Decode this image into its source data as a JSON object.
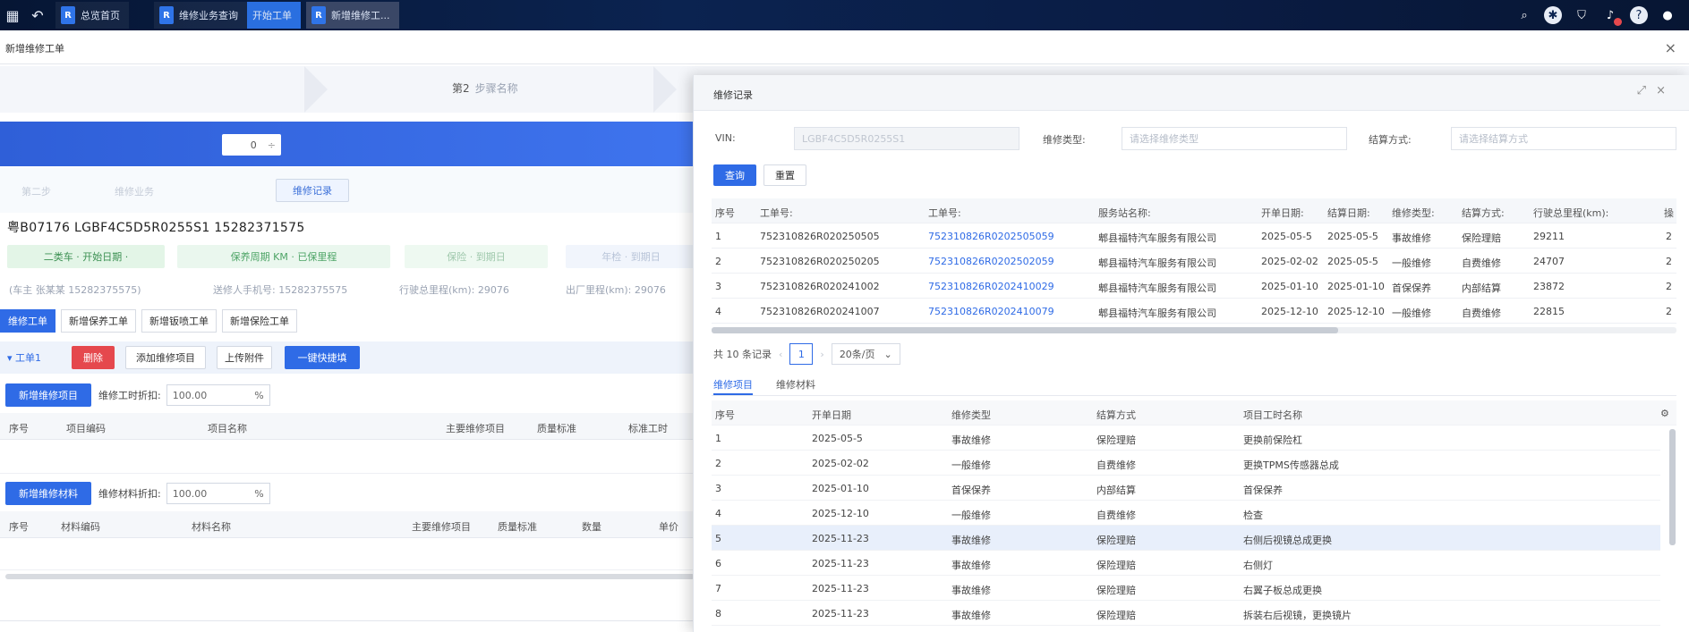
{
  "taskbar": {
    "tabs": [
      "总览首页",
      "维修业务查询",
      "开始工单",
      "新增维修工..."
    ],
    "icons": [
      "grid-icon",
      "back-icon",
      "search-icon",
      "settings-icon",
      "shield-icon",
      "bell-icon",
      "help-icon",
      "user-icon"
    ]
  },
  "window": {
    "title": "新增维修工单",
    "close": "×",
    "step_label_1": "第2",
    "step_label_2": "步骤名称"
  },
  "left": {
    "band_value": "0",
    "band_caret": "÷",
    "faint_1": "第二步",
    "faint_2": "维修业务",
    "history_button": "维修记录",
    "plate_line": "粤B07176  LGBF4C5D5R0255S1  15282371575",
    "chips": [
      "二类车 · 开始日期 ·",
      "保养周期 KM · 已保里程",
      "保险 · 到期日",
      "年检 · 到期日"
    ],
    "info": [
      "(车主 张某某 15282375575)",
      "送修人手机号: 15282375575",
      "行驶总里程(km): 29076",
      "出厂里程(km): 29076"
    ],
    "sub_tabs": [
      "维修工单",
      "新增保养工单",
      "新增钣喷工单",
      "新增保险工单"
    ],
    "section_toggle": "▾ 工单1",
    "btn_delete": "删除",
    "btn_add_project": "添加维修项目",
    "btn_upload": "上传附件",
    "btn_one_click": "一键快捷填",
    "btn_add_item": "新增维修项目",
    "discount_label": "维修工时折扣:",
    "discount_value": "100.00",
    "percent": "%",
    "table1_headers": [
      "序号",
      "项目编码",
      "项目名称",
      "主要维修项目",
      "质量标准",
      "标准工时"
    ],
    "btn_add_material": "新增维修材料",
    "material_label": "维修材料折扣:",
    "material_value": "100.00",
    "table2_headers": [
      "序号",
      "材料编码",
      "材料名称",
      "主要维修项目",
      "质量标准",
      "数量",
      "单价"
    ]
  },
  "modal": {
    "title": "维修记录",
    "max_icon": "⤢",
    "close_icon": "×",
    "vin_label": "VIN:",
    "vin_value": "LGBF4C5D5R0255S1",
    "type_label": "维修类型:",
    "type_placeholder": "请选择维修类型",
    "method_label": "结算方式:",
    "method_placeholder": "请选择结算方式",
    "search_btn": "查询",
    "reset_btn": "重置",
    "grid_headers": [
      "序号",
      "工单号:",
      "工单号:",
      "服务站名称:",
      "开单日期:",
      "结算日期:",
      "维修类型:",
      "结算方式:",
      "行驶总里程(km):",
      "操"
    ],
    "grid_rows": [
      [
        "1",
        "752310826R020250505",
        "752310826R0202505059",
        "郫县福特汽车服务有限公司",
        "2025-05-5",
        "2025-05-5",
        "事故维修",
        "保险理赔",
        "29211",
        "2"
      ],
      [
        "2",
        "752310826R020250205",
        "752310826R0202502059",
        "郫县福特汽车服务有限公司",
        "2025-02-02",
        "2025-05-5",
        "一般维修",
        "自费维修",
        "24707",
        "2"
      ],
      [
        "3",
        "752310826R020241002",
        "752310826R0202410029",
        "郫县福特汽车服务有限公司",
        "2025-01-10",
        "2025-01-10",
        "首保保养",
        "内部结算",
        "23872",
        "2"
      ],
      [
        "4",
        "752310826R020241007",
        "752310826R0202410079",
        "郫县福特汽车服务有限公司",
        "2025-12-10",
        "2025-12-10",
        "一般维修",
        "自费维修",
        "22815",
        "2"
      ]
    ],
    "pager_total": "共 10 条记录",
    "pager_prev": "‹",
    "pager_page": "1",
    "pager_next": "›",
    "pager_size": "20条/页",
    "pager_caret": "⌄",
    "tabs": [
      "维修项目",
      "维修材料"
    ],
    "detail_headers": [
      "序号",
      "开单日期",
      "维修类型",
      "结算方式",
      "项目工时名称",
      "⚙"
    ],
    "detail_rows": [
      [
        "1",
        "2025-05-5",
        "事故维修",
        "保险理赔",
        "更换前保险杠"
      ],
      [
        "2",
        "2025-02-02",
        "一般维修",
        "自费维修",
        "更换TPMS传感器总成"
      ],
      [
        "3",
        "2025-01-10",
        "首保保养",
        "内部结算",
        "首保保养"
      ],
      [
        "4",
        "2025-12-10",
        "一般维修",
        "自费维修",
        "检查"
      ],
      [
        "5",
        "2025-11-23",
        "事故维修",
        "保险理赔",
        "右侧后视镜总成更换"
      ],
      [
        "6",
        "2025-11-23",
        "事故维修",
        "保险理赔",
        "右侧灯"
      ],
      [
        "7",
        "2025-11-23",
        "事故维修",
        "保险理赔",
        "右翼子板总成更换"
      ],
      [
        "8",
        "2025-11-23",
        "事故维修",
        "保险理赔",
        "拆装右后视镜，更换镜片"
      ]
    ]
  }
}
